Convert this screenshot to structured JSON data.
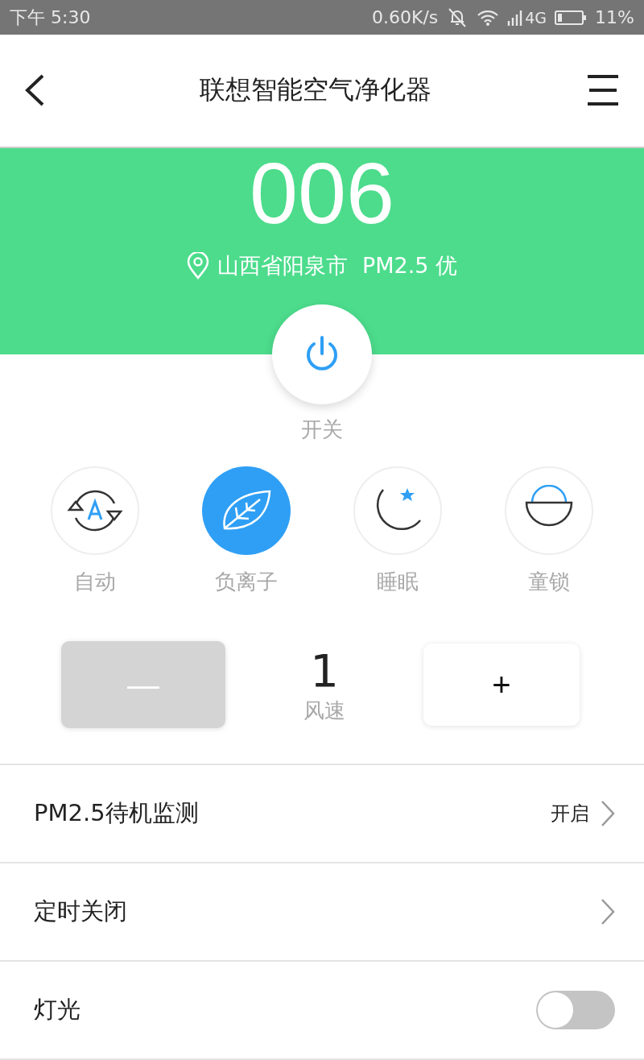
{
  "status_bar": {
    "time": "下午 5:30",
    "speed": "0.60K/s",
    "network": "4G",
    "battery": "11%"
  },
  "header": {
    "title": "联想智能空气净化器"
  },
  "air": {
    "value": "006",
    "location": "山西省阳泉市",
    "quality": "PM2.5 优"
  },
  "power": {
    "label": "开关",
    "on": true
  },
  "modes": [
    {
      "kind": "auto",
      "label": "自动",
      "selected": false
    },
    {
      "kind": "ion",
      "label": "负离子",
      "selected": true
    },
    {
      "kind": "sleep",
      "label": "睡眠",
      "selected": false
    },
    {
      "kind": "lock",
      "label": "童锁",
      "selected": false
    }
  ],
  "fan": {
    "minus": "—",
    "plus": "+",
    "minus_disabled": true,
    "value": "1",
    "label": "风速"
  },
  "settings": [
    {
      "kind": "link",
      "label": "PM2.5待机监测",
      "value": "开启"
    },
    {
      "kind": "link",
      "label": "定时关闭"
    },
    {
      "kind": "toggle",
      "label": "灯光",
      "on": false
    }
  ]
}
